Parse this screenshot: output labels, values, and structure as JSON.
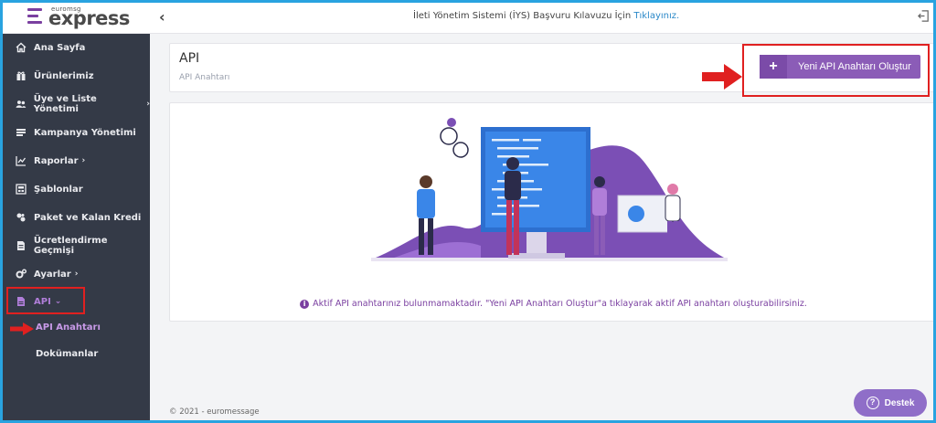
{
  "topbar": {
    "logo_small": "euromsg",
    "logo_text": "express",
    "notice_text": "İleti Yönetim Sistemi (İYS) Başvuru Kılavuzu İçin ",
    "notice_link": "Tıklayınız."
  },
  "sidebar": {
    "items": [
      {
        "label": "Ana Sayfa",
        "icon": "home-icon"
      },
      {
        "label": "Ürünlerimiz",
        "icon": "gift-icon"
      },
      {
        "label": "Üye ve Liste Yönetimi",
        "icon": "users-icon",
        "chevron": "›"
      },
      {
        "label": "Kampanya Yönetimi",
        "icon": "campaign-icon"
      },
      {
        "label": "Raporlar",
        "icon": "chart-icon",
        "chevron": "›"
      },
      {
        "label": "Şablonlar",
        "icon": "template-icon"
      },
      {
        "label": "Paket ve Kalan Kredi",
        "icon": "package-icon"
      },
      {
        "label": "Ücretlendirme Geçmişi",
        "icon": "billing-icon"
      },
      {
        "label": "Ayarlar",
        "icon": "gear-icon",
        "chevron": "›"
      },
      {
        "label": "API",
        "icon": "file-icon",
        "chevron": "⌄"
      }
    ],
    "sub_items": [
      {
        "label": "API Anahtarı"
      },
      {
        "label": "Dokümanlar"
      }
    ]
  },
  "main": {
    "title": "API",
    "subtitle": "API Anahtarı",
    "new_button": "Yeni API Anahtarı Oluştur",
    "info_text": "Aktif API anahtarınız bulunmamaktadır. \"Yeni API Anahtarı Oluştur\"a tıklayarak aktif API anahtarı oluşturabilirsiniz.",
    "footer": "© 2021 - euromessage",
    "support_label": "Destek"
  },
  "colors": {
    "accent": "#8b5cb7",
    "sidebar_bg": "#343a47",
    "highlight": "#e02020",
    "link": "#2a88c8"
  }
}
